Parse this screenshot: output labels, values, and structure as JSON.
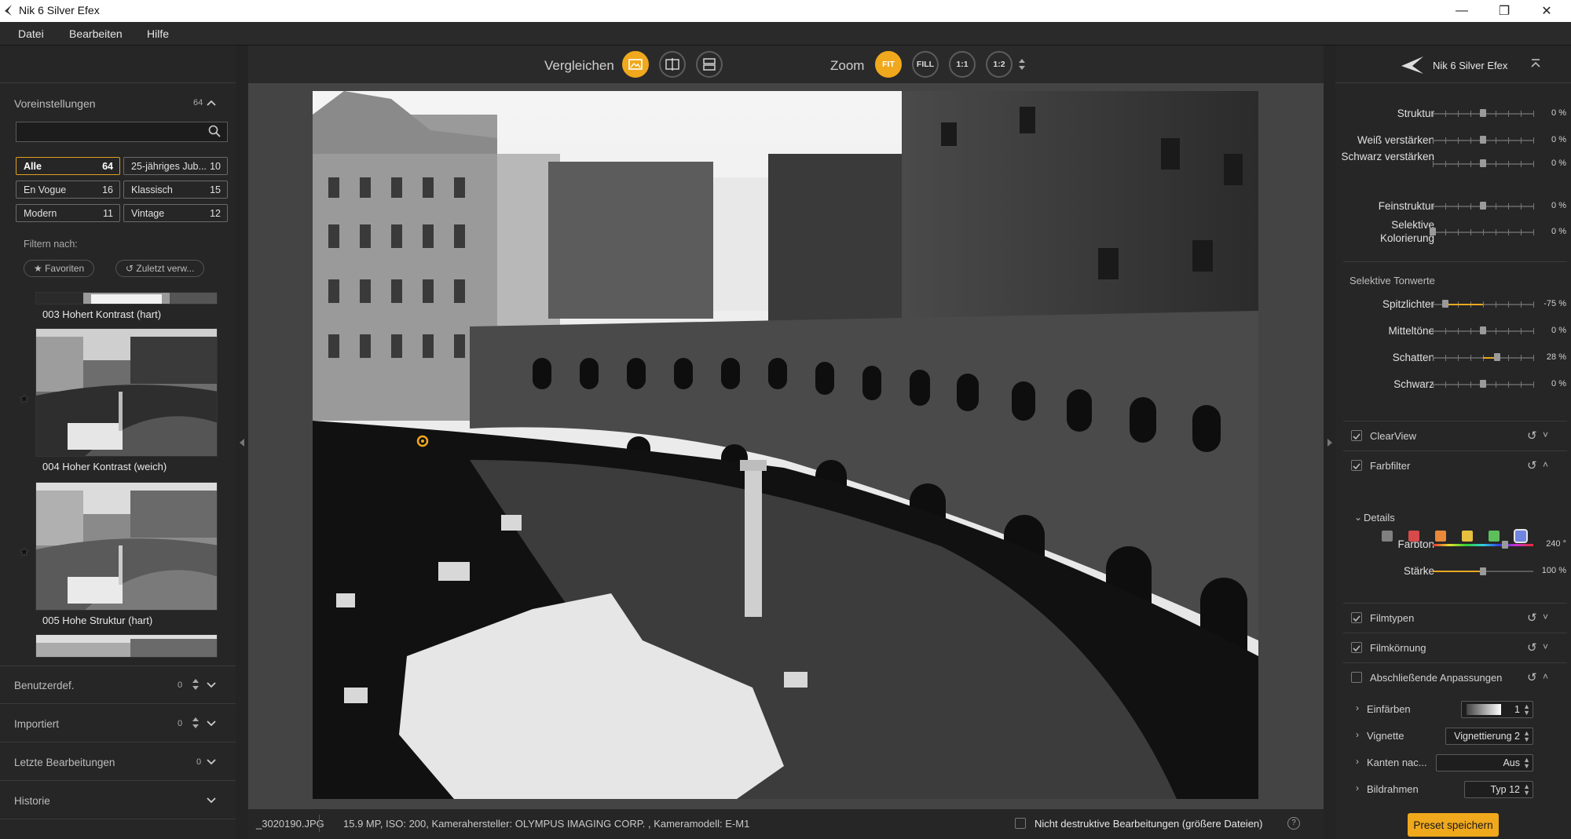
{
  "window": {
    "title": "Nik 6 Silver Efex",
    "controls": [
      "minimize-icon",
      "maximize-icon",
      "close-icon"
    ]
  },
  "menu": [
    "Datei",
    "Bearbeiten",
    "Hilfe"
  ],
  "left": {
    "presets_title": "Voreinstellungen",
    "presets_count": "64",
    "search_placeholder": "",
    "categories": [
      {
        "label": "Alle",
        "count": "64",
        "active": true
      },
      {
        "label": "25-jähriges Jub...",
        "count": "10",
        "active": false
      },
      {
        "label": "En Vogue",
        "count": "16",
        "active": false
      },
      {
        "label": "Klassisch",
        "count": "15",
        "active": false
      },
      {
        "label": "Modern",
        "count": "11",
        "active": false
      },
      {
        "label": "Vintage",
        "count": "12",
        "active": false
      }
    ],
    "filter_label": "Filtern nach:",
    "filter_pills": [
      "Favoriten",
      "Zuletzt verw..."
    ],
    "thumbs": [
      {
        "caption": "003 Hohert Kontrast (hart)"
      },
      {
        "caption": "004 Hoher Kontrast (weich)"
      },
      {
        "caption": "005 Hohe Struktur (hart)"
      }
    ],
    "sections": [
      {
        "label": "Benutzerdef.",
        "count": "0"
      },
      {
        "label": "Importiert",
        "count": "0"
      },
      {
        "label": "Letzte Bearbeitungen",
        "count": "0"
      },
      {
        "label": "Historie",
        "count": ""
      }
    ]
  },
  "toolbar": {
    "compare_label": "Vergleichen",
    "zoom_label": "Zoom",
    "zoom_buttons": [
      "FIT",
      "FILL",
      "1:1",
      "1:2"
    ]
  },
  "status": {
    "filename": "_3020190.JPG",
    "info": "15.9 MP, ISO: 200, Kamerahersteller: OLYMPUS IMAGING CORP.  , Kameramodell: E-M1",
    "nondestructive_label": "Nicht destruktive Bearbeitungen (größere Dateien)"
  },
  "right": {
    "header_title": "Nik 6 Silver Efex",
    "top_sliders": [
      {
        "label": "Struktur",
        "value": "0 %",
        "pos": 0.5
      },
      {
        "label": "Weiß verstärken",
        "value": "0 %",
        "pos": 0.5
      },
      {
        "label": "Schwarz verstärken",
        "value": "0 %",
        "pos": 0.5
      },
      {
        "label": "Feinstruktur",
        "value": "0 %",
        "pos": 0.5
      },
      {
        "label": "Selektive Kolorierung",
        "value": "0 %",
        "pos": 0.0
      }
    ],
    "tonal_title": "Selektive Tonwerte",
    "tonal_sliders": [
      {
        "label": "Spitzlichter",
        "value": "-75 %",
        "pos": 0.125,
        "fill_from": 0.125,
        "fill_to": 0.5
      },
      {
        "label": "Mitteltöne",
        "value": "0 %",
        "pos": 0.5
      },
      {
        "label": "Schatten",
        "value": "28 %",
        "pos": 0.64,
        "fill_from": 0.5,
        "fill_to": 0.64
      },
      {
        "label": "Schwarz",
        "value": "0 %",
        "pos": 0.5
      }
    ],
    "sections": [
      {
        "label": "ClearView",
        "checked": true
      },
      {
        "label": "Farbfilter",
        "checked": true
      },
      {
        "label": "Filmtypen",
        "checked": true
      },
      {
        "label": "Filmkörnung",
        "checked": true
      },
      {
        "label": "Abschließende Anpassungen",
        "checked": false
      }
    ],
    "swatches": [
      "#808080",
      "#d84a4a",
      "#e88a3a",
      "#e8c040",
      "#5cbf5c",
      "#6f86e0"
    ],
    "details_label": "Details",
    "farbton": {
      "label": "Farbton",
      "value": "240 °",
      "pos": 0.67
    },
    "staerke": {
      "label": "Stärke",
      "value": "100 %",
      "pos": 0.5
    },
    "final": [
      {
        "label": "Einfärben",
        "value": "1"
      },
      {
        "label": "Vignette",
        "value": "Vignettierung 2"
      },
      {
        "label": "Kanten nac...",
        "value": "Aus"
      },
      {
        "label": "Bildrahmen",
        "value": "Typ 12"
      }
    ],
    "save_button": "Preset speichern"
  },
  "colors": {
    "accent": "#f0a81c",
    "panel": "#262626",
    "canvas": "#444444"
  }
}
